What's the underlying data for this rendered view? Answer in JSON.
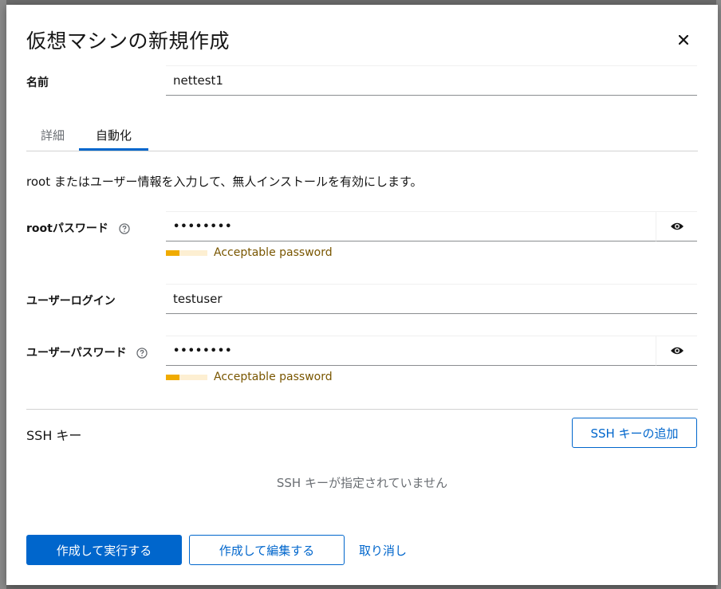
{
  "dialog": {
    "title": "仮想マシンの新規作成",
    "close_icon": "close-icon"
  },
  "name_field": {
    "label": "名前",
    "value": "nettest1"
  },
  "tabs": [
    {
      "label": "詳細",
      "active": false
    },
    {
      "label": "自動化",
      "active": true
    }
  ],
  "automation": {
    "description": "root またはユーザー情報を入力して、無人インストールを有効にします。",
    "root_password": {
      "label": "rootパスワード",
      "value": "••••••••",
      "strength_text": "Acceptable password",
      "strength_level": 0.33
    },
    "user_login": {
      "label": "ユーザーログイン",
      "value": "testuser"
    },
    "user_password": {
      "label": "ユーザーパスワード",
      "value": "••••••••",
      "strength_text": "Acceptable password",
      "strength_level": 0.33
    }
  },
  "ssh": {
    "label": "SSH キー",
    "add_button": "SSH キーの追加",
    "empty_text": "SSH キーが指定されていません"
  },
  "footer": {
    "create_run": "作成して実行する",
    "create_edit": "作成して編集する",
    "cancel": "取り消し"
  },
  "colors": {
    "primary": "#0066cc",
    "warning": "#f0ab00",
    "warning_text": "#795600"
  }
}
